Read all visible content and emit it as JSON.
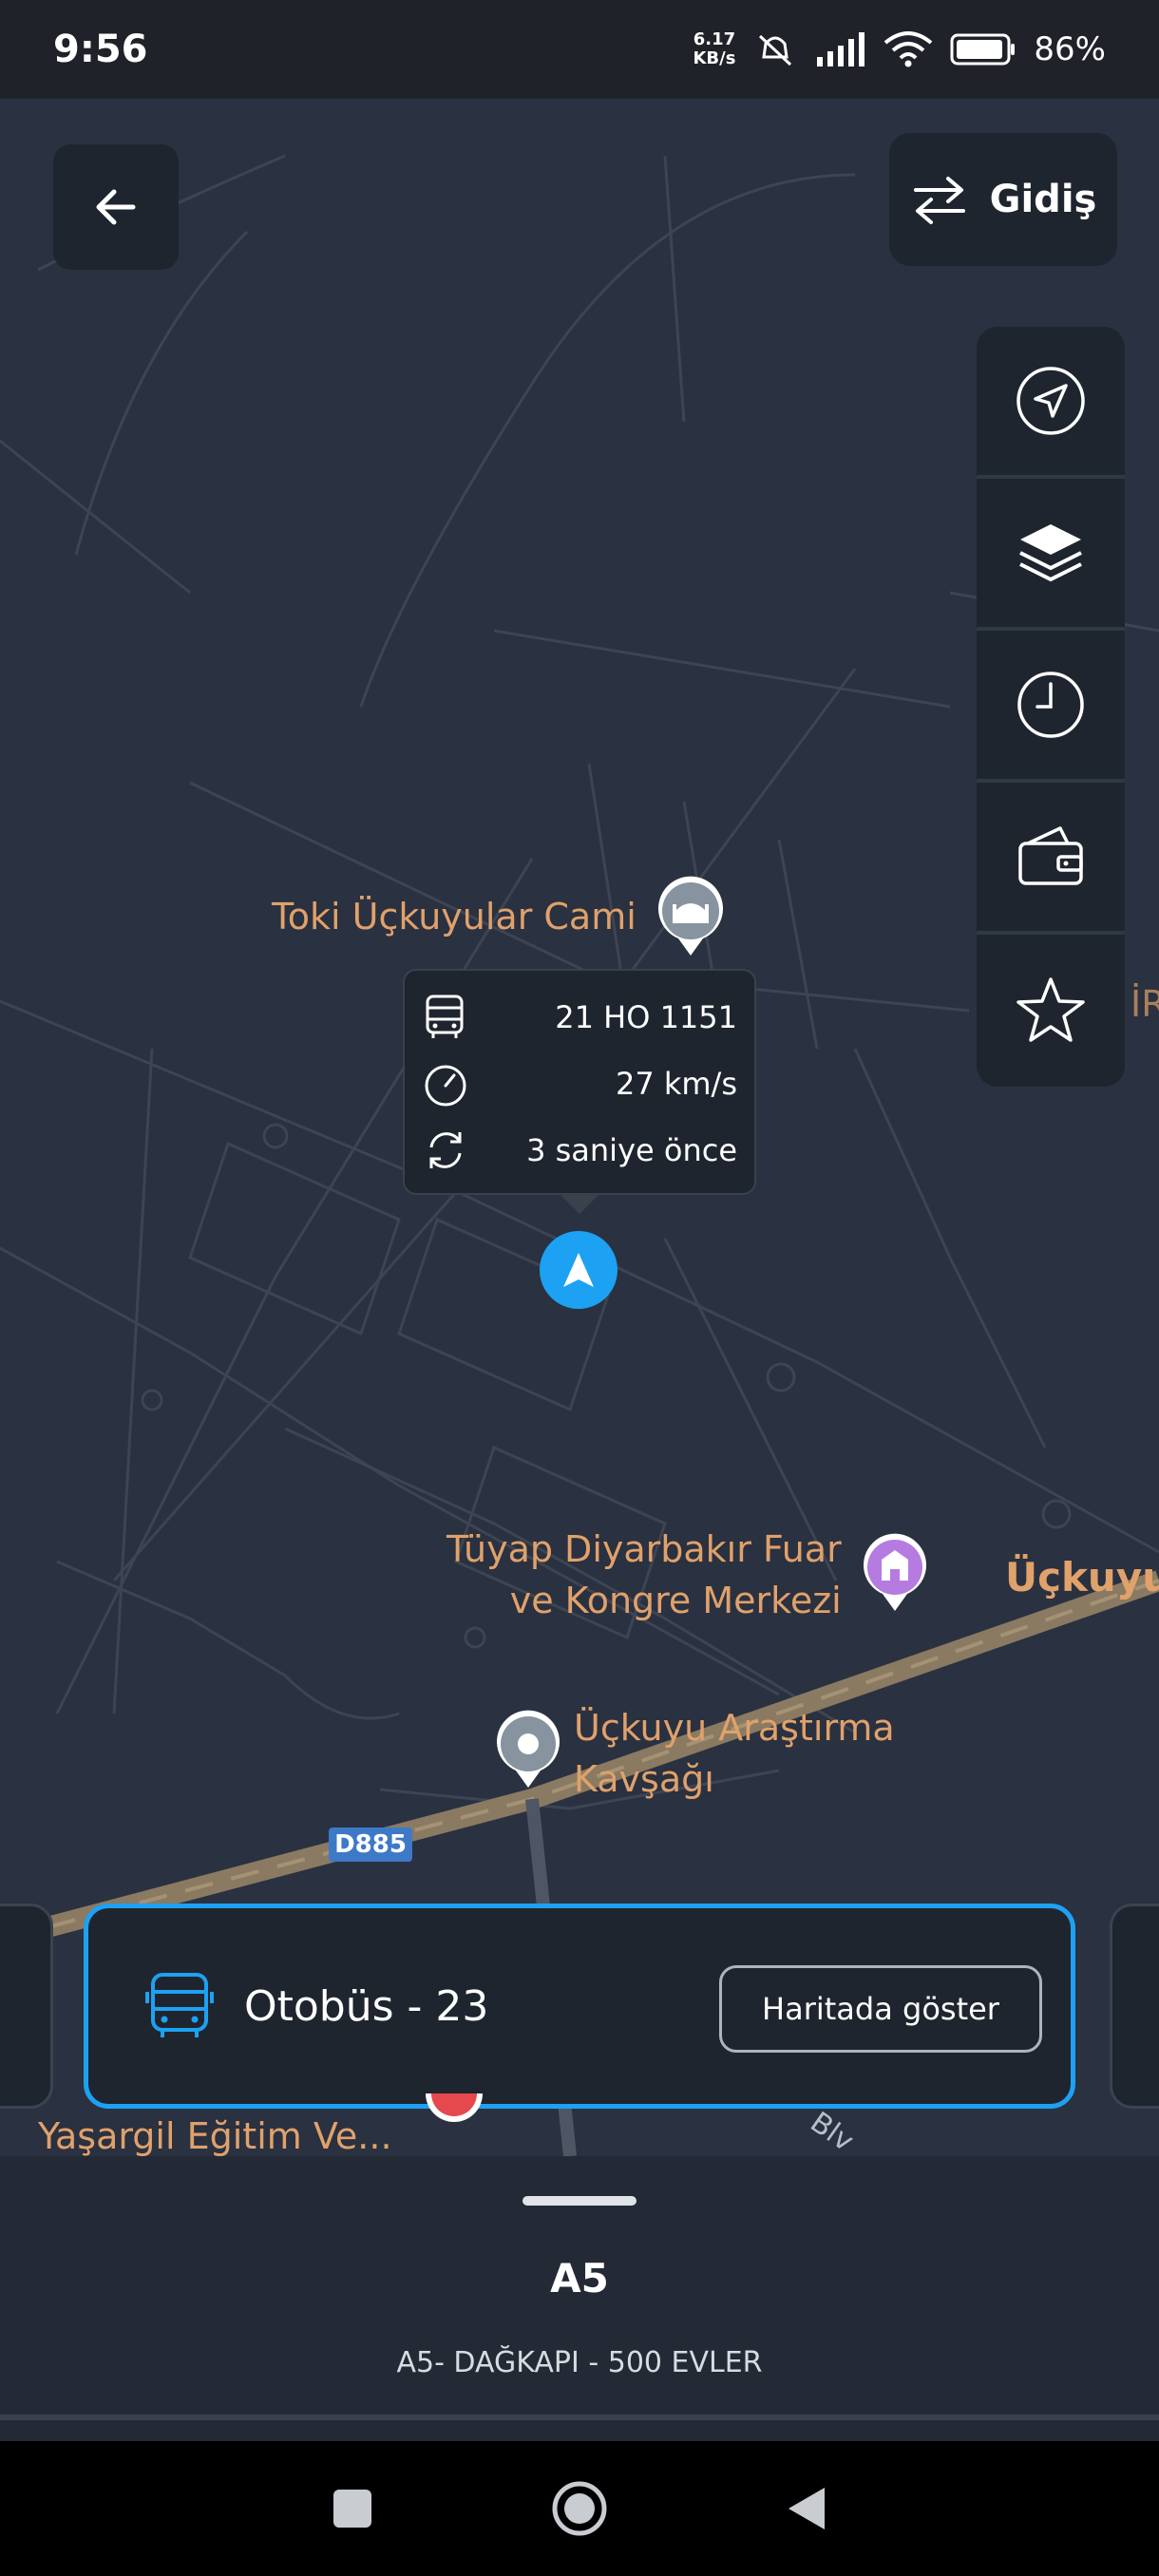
{
  "status": {
    "time": "9:56",
    "net_speed_value": "6.17",
    "net_speed_unit": "KB/s",
    "battery": "86%"
  },
  "header": {
    "direction_label": "Gidiş"
  },
  "map": {
    "poi_mosque": "Toki Üçkuyular Cami",
    "poi_fair_line1": "Tüyap Diyarbakır Fuar",
    "poi_fair_line2": "ve Kongre Merkezi",
    "poi_junction_line1": "Üçkuyu Araştırma",
    "poi_junction_line2": "Kavşağı",
    "poi_school": "Yaşargil Eğitim Ve...",
    "district_label": "Üçkuyu",
    "road_shield": "D885",
    "edge_fragment": "İR",
    "street_fragment": "Blv"
  },
  "vehicle_popup": {
    "plate": "21 HO 1151",
    "speed": "27 km/s",
    "updated": "3 saniye önce"
  },
  "vehicle_card": {
    "title": "Otobüs - 23",
    "show_on_map_label": "Haritada göster"
  },
  "sheet": {
    "route_code": "A5",
    "route_name": "A5- DAĞKAPI - 500 EVLER"
  },
  "colors": {
    "accent": "#1da1f2",
    "poi_text": "#e0a16b",
    "map_bg": "#2a3140",
    "panel_bg": "#1f252f"
  }
}
